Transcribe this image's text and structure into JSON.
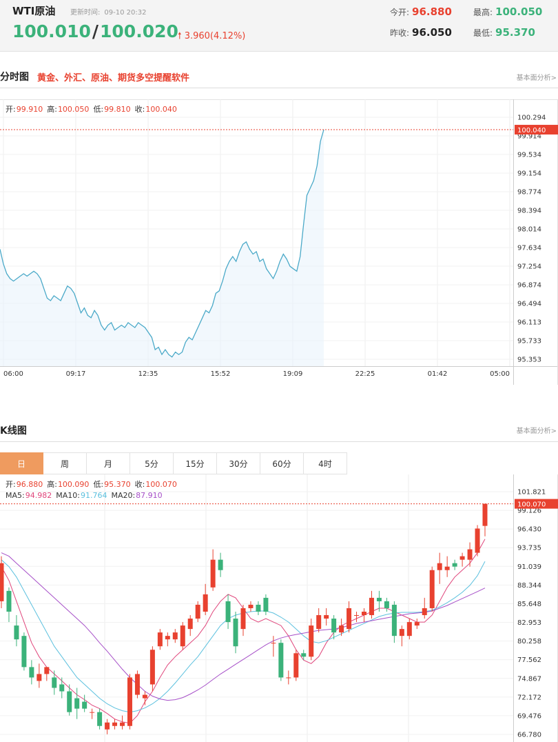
{
  "quote": {
    "name": "WTI原油",
    "time_label": "更新时间:",
    "time": "09-10 20:32",
    "bid": "100.010",
    "slash": "/",
    "ask": "100.020",
    "change": "3.960(4.12%)",
    "open_label": "今开:",
    "open": "96.880",
    "high_label": "最高:",
    "high": "100.050",
    "prev_label": "昨收:",
    "prev": "96.050",
    "low_label": "最低:",
    "low": "95.370"
  },
  "colors": {
    "up": "#e8412f",
    "down": "#3bb27a",
    "line": "#4aa9c8",
    "ma5": "#e0457b",
    "ma10": "#5bc0de",
    "ma20": "#a64fc8",
    "active_tab": "#ef9b5f"
  },
  "intraday": {
    "title": "分时图",
    "ad": "黄金、外汇、原油、期货多空提醒软件",
    "link": "基本面分析>",
    "ohlc": [
      {
        "label": "开:",
        "value": "99.910"
      },
      {
        "label": "高:",
        "value": "100.050"
      },
      {
        "label": "低:",
        "value": "99.810"
      },
      {
        "label": "收:",
        "value": "100.040"
      }
    ],
    "last_price_tag": "100.040"
  },
  "kline": {
    "title": "K线图",
    "link": "基本面分析>",
    "tabs": [
      "日",
      "周",
      "月",
      "5分",
      "15分",
      "30分",
      "60分",
      "4时"
    ],
    "active_tab": "日",
    "ohlc": [
      {
        "label": "开:",
        "value": "96.880"
      },
      {
        "label": "高:",
        "value": "100.090"
      },
      {
        "label": "低:",
        "value": "95.370"
      },
      {
        "label": "收:",
        "value": "100.070"
      }
    ],
    "ma": [
      {
        "label": "MA5:",
        "value": "94.982"
      },
      {
        "label": "MA10:",
        "value": "91.764"
      },
      {
        "label": "MA20:",
        "value": "87.910"
      }
    ],
    "last_price_tag": "100.070"
  },
  "chart_data": [
    {
      "type": "line",
      "title": "分时图",
      "x_ticks": [
        "06:00",
        "09:17",
        "12:35",
        "15:52",
        "19:09",
        "22:25",
        "01:42",
        "05:00"
      ],
      "y_ticks": [
        "100.294",
        "99.914",
        "99.534",
        "99.154",
        "98.774",
        "98.394",
        "98.014",
        "97.634",
        "97.254",
        "96.874",
        "96.494",
        "96.113",
        "95.733",
        "95.353"
      ],
      "ylim": [
        95.353,
        100.294
      ],
      "y_ref": 100.04,
      "series": [
        {
          "values": [
            97.6,
            97.3,
            97.1,
            97.0,
            96.95,
            97.0,
            97.05,
            97.1,
            97.05,
            97.1,
            97.15,
            97.1,
            97.0,
            96.8,
            96.6,
            96.55,
            96.65,
            96.6,
            96.55,
            96.7,
            96.85,
            96.8,
            96.7,
            96.5,
            96.3,
            96.4,
            96.25,
            96.2,
            96.35,
            96.25,
            96.05,
            95.95,
            96.05,
            96.1,
            95.95,
            96.0,
            96.05,
            96.0,
            96.1,
            96.05,
            96.0,
            96.1,
            96.05,
            96.0,
            95.9,
            95.8,
            95.55,
            95.6,
            95.45,
            95.55,
            95.45,
            95.4,
            95.5,
            95.45,
            95.5,
            95.7,
            95.8,
            95.75,
            95.9,
            96.05,
            96.2,
            96.35,
            96.3,
            96.45,
            96.7,
            96.75,
            96.95,
            97.2,
            97.35,
            97.45,
            97.35,
            97.55,
            97.7,
            97.75,
            97.6,
            97.5,
            97.55,
            97.35,
            97.4,
            97.2,
            97.1,
            97.0,
            97.15,
            97.35,
            97.5,
            97.4,
            97.25,
            97.2,
            97.15,
            97.45,
            98.1,
            98.7,
            98.85,
            99.0,
            99.3,
            99.8,
            100.04
          ]
        }
      ]
    },
    {
      "type": "candlestick",
      "title": "K线图",
      "y_ticks": [
        "101.821",
        "99.126",
        "96.430",
        "93.735",
        "91.039",
        "88.344",
        "85.648",
        "82.953",
        "80.258",
        "77.562",
        "74.867",
        "72.172",
        "69.476",
        "66.780"
      ],
      "ylim": [
        66.78,
        101.821
      ],
      "y_ref": 100.07,
      "candles": [
        {
          "o": 86.0,
          "h": 92.5,
          "l": 85.0,
          "c": 91.5
        },
        {
          "o": 87.5,
          "h": 88.0,
          "l": 83.0,
          "c": 84.5
        },
        {
          "o": 82.5,
          "h": 84.0,
          "l": 79.5,
          "c": 80.5
        },
        {
          "o": 81.0,
          "h": 81.5,
          "l": 76.0,
          "c": 76.5
        },
        {
          "o": 76.5,
          "h": 77.5,
          "l": 74.0,
          "c": 75.0
        },
        {
          "o": 74.5,
          "h": 77.0,
          "l": 73.5,
          "c": 75.5
        },
        {
          "o": 75.5,
          "h": 76.5,
          "l": 74.5,
          "c": 76.5
        },
        {
          "o": 75.0,
          "h": 76.0,
          "l": 72.5,
          "c": 73.5
        },
        {
          "o": 74.0,
          "h": 75.0,
          "l": 72.0,
          "c": 73.0
        },
        {
          "o": 73.0,
          "h": 74.0,
          "l": 69.5,
          "c": 70.0
        },
        {
          "o": 72.0,
          "h": 73.5,
          "l": 69.0,
          "c": 70.5
        },
        {
          "o": 71.5,
          "h": 72.5,
          "l": 70.0,
          "c": 70.5
        },
        {
          "o": 70.0,
          "h": 70.5,
          "l": 69.0,
          "c": 70.0
        },
        {
          "o": 70.0,
          "h": 70.5,
          "l": 67.5,
          "c": 68.0
        },
        {
          "o": 67.5,
          "h": 69.0,
          "l": 66.8,
          "c": 68.5
        },
        {
          "o": 68.0,
          "h": 69.0,
          "l": 67.5,
          "c": 68.5
        },
        {
          "o": 68.0,
          "h": 69.5,
          "l": 67.5,
          "c": 68.5
        },
        {
          "o": 68.0,
          "h": 75.5,
          "l": 67.5,
          "c": 75.0
        },
        {
          "o": 72.5,
          "h": 76.0,
          "l": 72.0,
          "c": 75.5
        },
        {
          "o": 72.0,
          "h": 73.0,
          "l": 71.0,
          "c": 72.5
        },
        {
          "o": 74.0,
          "h": 79.5,
          "l": 73.0,
          "c": 79.0
        },
        {
          "o": 79.5,
          "h": 82.0,
          "l": 79.0,
          "c": 81.5
        },
        {
          "o": 80.5,
          "h": 81.5,
          "l": 79.5,
          "c": 81.0
        },
        {
          "o": 80.5,
          "h": 82.0,
          "l": 80.0,
          "c": 81.5
        },
        {
          "o": 79.5,
          "h": 83.0,
          "l": 79.0,
          "c": 82.5
        },
        {
          "o": 82.0,
          "h": 84.0,
          "l": 81.0,
          "c": 83.5
        },
        {
          "o": 83.5,
          "h": 86.0,
          "l": 83.0,
          "c": 85.5
        },
        {
          "o": 84.5,
          "h": 88.5,
          "l": 84.0,
          "c": 87.0
        },
        {
          "o": 88.0,
          "h": 93.5,
          "l": 87.5,
          "c": 92.0
        },
        {
          "o": 92.0,
          "h": 93.0,
          "l": 89.5,
          "c": 90.5
        },
        {
          "o": 86.0,
          "h": 87.0,
          "l": 82.0,
          "c": 83.0
        },
        {
          "o": 83.5,
          "h": 84.5,
          "l": 78.5,
          "c": 79.5
        },
        {
          "o": 82.0,
          "h": 85.5,
          "l": 81.0,
          "c": 85.0
        },
        {
          "o": 85.0,
          "h": 86.0,
          "l": 84.5,
          "c": 85.5
        },
        {
          "o": 85.5,
          "h": 86.0,
          "l": 84.0,
          "c": 84.5
        },
        {
          "o": 86.5,
          "h": 87.0,
          "l": 84.0,
          "c": 84.5
        },
        {
          "o": 80.0,
          "h": 81.0,
          "l": 78.0,
          "c": 80.0
        },
        {
          "o": 80.0,
          "h": 80.5,
          "l": 74.5,
          "c": 75.0
        },
        {
          "o": 75.0,
          "h": 76.0,
          "l": 74.0,
          "c": 75.0
        },
        {
          "o": 75.0,
          "h": 79.0,
          "l": 74.5,
          "c": 78.5
        },
        {
          "o": 78.5,
          "h": 79.0,
          "l": 77.5,
          "c": 78.0
        },
        {
          "o": 78.0,
          "h": 83.5,
          "l": 77.5,
          "c": 82.5
        },
        {
          "o": 82.0,
          "h": 85.0,
          "l": 81.5,
          "c": 84.0
        },
        {
          "o": 83.5,
          "h": 85.0,
          "l": 82.5,
          "c": 84.0
        },
        {
          "o": 83.5,
          "h": 84.0,
          "l": 80.5,
          "c": 81.5
        },
        {
          "o": 81.5,
          "h": 83.5,
          "l": 81.0,
          "c": 82.5
        },
        {
          "o": 82.0,
          "h": 86.0,
          "l": 81.5,
          "c": 85.0
        },
        {
          "o": 84.0,
          "h": 84.5,
          "l": 83.0,
          "c": 84.0
        },
        {
          "o": 84.0,
          "h": 85.0,
          "l": 83.0,
          "c": 84.5
        },
        {
          "o": 84.0,
          "h": 87.5,
          "l": 83.5,
          "c": 86.5
        },
        {
          "o": 86.5,
          "h": 87.5,
          "l": 84.5,
          "c": 86.0
        },
        {
          "o": 86.0,
          "h": 86.5,
          "l": 84.5,
          "c": 85.0
        },
        {
          "o": 85.5,
          "h": 86.0,
          "l": 80.0,
          "c": 81.0
        },
        {
          "o": 81.0,
          "h": 82.5,
          "l": 79.5,
          "c": 82.0
        },
        {
          "o": 81.0,
          "h": 83.5,
          "l": 80.5,
          "c": 83.0
        },
        {
          "o": 82.5,
          "h": 83.5,
          "l": 82.0,
          "c": 83.0
        },
        {
          "o": 84.0,
          "h": 86.5,
          "l": 83.5,
          "c": 85.0
        },
        {
          "o": 85.0,
          "h": 91.0,
          "l": 84.5,
          "c": 90.5
        },
        {
          "o": 90.5,
          "h": 93.0,
          "l": 88.5,
          "c": 91.5
        },
        {
          "o": 90.5,
          "h": 92.5,
          "l": 89.5,
          "c": 91.0
        },
        {
          "o": 91.5,
          "h": 92.0,
          "l": 90.5,
          "c": 91.0
        },
        {
          "o": 92.0,
          "h": 93.0,
          "l": 91.0,
          "c": 92.5
        },
        {
          "o": 92.0,
          "h": 94.5,
          "l": 91.0,
          "c": 93.5
        },
        {
          "o": 93.0,
          "h": 97.0,
          "l": 92.5,
          "c": 96.5
        },
        {
          "o": 96.88,
          "h": 100.09,
          "l": 95.37,
          "c": 100.07
        }
      ],
      "series": [
        {
          "name": "MA5",
          "values": [
            91.0,
            89.0,
            86.0,
            83.0,
            80.0,
            78.0,
            76.5,
            75.5,
            74.5,
            73.5,
            72.5,
            71.8,
            71.0,
            70.5,
            69.8,
            69.0,
            68.6,
            68.4,
            69.5,
            71.5,
            73.0,
            75.0,
            76.8,
            78.0,
            79.0,
            80.0,
            81.0,
            82.5,
            84.5,
            86.0,
            87.0,
            86.5,
            85.0,
            83.5,
            83.0,
            83.5,
            83.0,
            82.5,
            81.0,
            79.0,
            77.5,
            77.0,
            78.0,
            80.0,
            81.5,
            82.5,
            83.0,
            83.5,
            84.0,
            84.5,
            85.0,
            85.0,
            84.5,
            84.0,
            83.5,
            83.0,
            83.0,
            84.0,
            86.0,
            88.0,
            89.5,
            90.5,
            91.5,
            93.0,
            94.98
          ]
        },
        {
          "name": "MA10",
          "values": [
            92.0,
            91.0,
            89.5,
            87.5,
            85.5,
            83.5,
            81.5,
            79.5,
            78.0,
            76.5,
            75.0,
            74.0,
            73.0,
            72.0,
            71.2,
            70.6,
            70.2,
            70.0,
            70.2,
            70.6,
            71.2,
            72.0,
            73.0,
            74.2,
            75.5,
            76.8,
            78.0,
            79.5,
            81.0,
            82.5,
            83.5,
            84.0,
            84.3,
            84.5,
            84.6,
            84.6,
            84.3,
            83.7,
            83.0,
            82.0,
            81.0,
            80.2,
            80.0,
            80.3,
            80.8,
            81.3,
            81.8,
            82.3,
            82.8,
            83.3,
            83.8,
            84.1,
            84.3,
            84.4,
            84.4,
            84.4,
            84.5,
            84.7,
            85.2,
            85.8,
            86.5,
            87.3,
            88.3,
            89.7,
            91.76
          ]
        },
        {
          "name": "MA20",
          "values": [
            93.0,
            92.5,
            91.5,
            90.5,
            89.5,
            88.5,
            87.5,
            86.5,
            85.5,
            84.5,
            83.5,
            82.5,
            81.3,
            80.0,
            78.8,
            77.5,
            76.2,
            75.0,
            74.0,
            73.0,
            72.3,
            71.9,
            71.7,
            71.8,
            72.1,
            72.6,
            73.2,
            73.9,
            74.7,
            75.5,
            76.2,
            76.9,
            77.6,
            78.3,
            79.0,
            79.7,
            80.3,
            80.7,
            81.0,
            81.2,
            81.4,
            81.6,
            81.8,
            81.9,
            82.0,
            82.2,
            82.5,
            82.8,
            83.0,
            83.2,
            83.4,
            83.6,
            83.8,
            84.0,
            84.2,
            84.3,
            84.4,
            84.6,
            85.0,
            85.4,
            85.9,
            86.4,
            86.9,
            87.4,
            87.91
          ]
        }
      ]
    }
  ]
}
